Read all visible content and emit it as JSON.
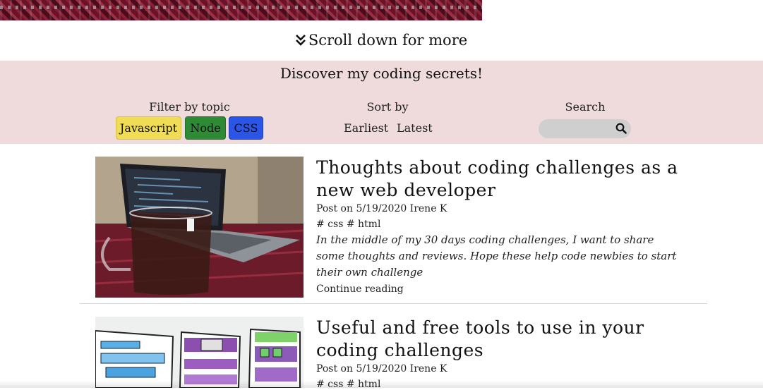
{
  "scroll_hint": "Scroll down for more",
  "banner": {
    "title": "Discover my coding secrets!",
    "filter_label": "Filter by topic",
    "topics": [
      "Javascript",
      "Node",
      "CSS"
    ],
    "sort_label": "Sort by",
    "sort_options": [
      "Earliest",
      "Latest"
    ],
    "search_label": "Search",
    "search_placeholder": ""
  },
  "posts": [
    {
      "title": "Thoughts about coding challenges as a new web developer",
      "meta": "Post on 5/19/2020 Irene K",
      "tags": "# css # html",
      "excerpt": "In the middle of my 30 days coding challenges, I want to share some thoughts and reviews. Hope these help code newbies to start their own challenge",
      "link": "Continue reading"
    },
    {
      "title": "Useful and free tools to use in your coding challenges",
      "meta": "Post on 5/19/2020 Irene K",
      "tags": "# css # html"
    }
  ],
  "colors": {
    "banner_bg": "#efdbdb",
    "javascript": "#f0dc55",
    "node": "#2f8a35",
    "css": "#2b55e6"
  }
}
